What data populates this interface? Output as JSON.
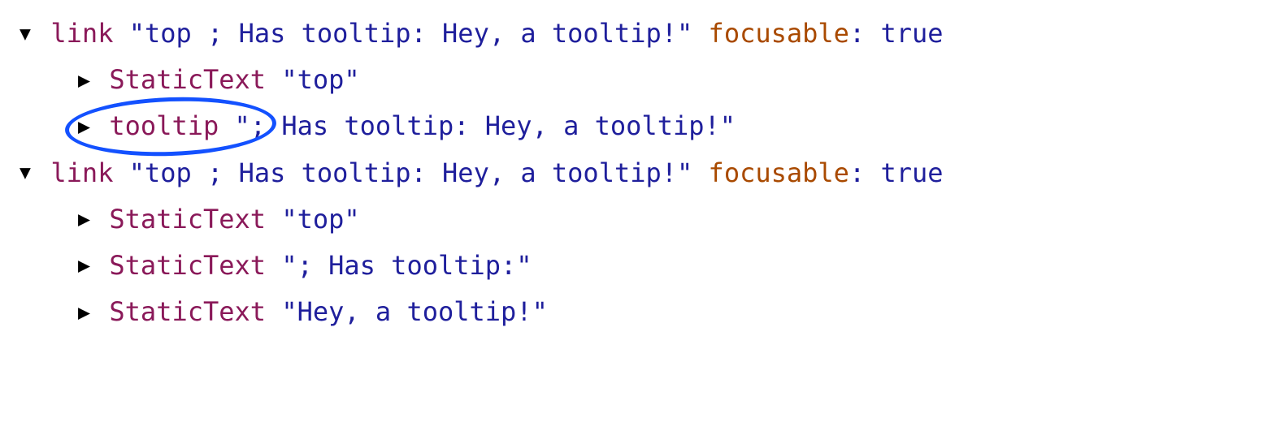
{
  "rows": [
    {
      "indent": 0,
      "arrow": "expanded",
      "role": "link",
      "name": "\"top ; Has tooltip: Hey, a tooltip!\"",
      "attr_key": "focusable",
      "attr_val": "true"
    },
    {
      "indent": 1,
      "arrow": "collapsed",
      "role": "StaticText",
      "name": "\"top\""
    },
    {
      "indent": 1,
      "arrow": "collapsed",
      "role": "tooltip",
      "name": "\"; Has tooltip: Hey, a tooltip!\"",
      "circled": true
    },
    {
      "indent": 0,
      "arrow": "expanded",
      "role": "link",
      "name": "\"top ; Has tooltip: Hey, a tooltip!\"",
      "attr_key": "focusable",
      "attr_val": "true"
    },
    {
      "indent": 1,
      "arrow": "collapsed",
      "role": "StaticText",
      "name": "\"top\""
    },
    {
      "indent": 1,
      "arrow": "collapsed",
      "role": "StaticText",
      "name": "\"; Has tooltip:\""
    },
    {
      "indent": 1,
      "arrow": "collapsed",
      "role": "StaticText",
      "name": "\"Hey, a tooltip!\""
    }
  ],
  "annotation": {
    "color": "#1351ff"
  }
}
